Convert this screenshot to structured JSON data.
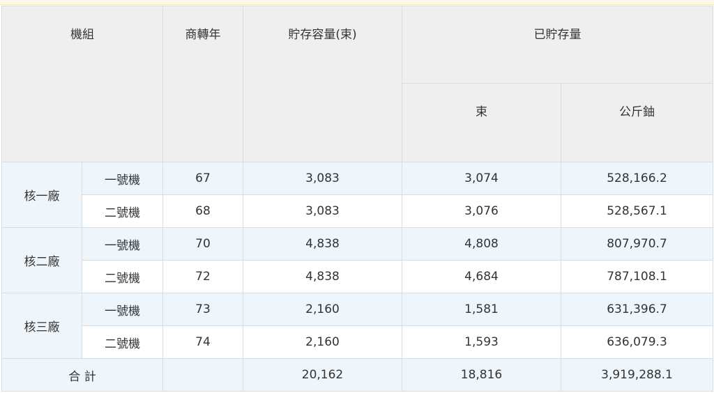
{
  "header": {
    "unit": "機組",
    "commercial_year": "商轉年",
    "capacity": "貯存容量(束)",
    "stored": "已貯存量",
    "stored_bundles": "束",
    "stored_kg": "公斤鈾"
  },
  "plants": [
    {
      "name": "核一廠",
      "units": [
        {
          "unit": "一號機",
          "year": "67",
          "capacity": "3,083",
          "bundles": "3,074",
          "kg": "528,166.2"
        },
        {
          "unit": "二號機",
          "year": "68",
          "capacity": "3,083",
          "bundles": "3,076",
          "kg": "528,567.1"
        }
      ]
    },
    {
      "name": "核二廠",
      "units": [
        {
          "unit": "一號機",
          "year": "70",
          "capacity": "4,838",
          "bundles": "4,808",
          "kg": "807,970.7"
        },
        {
          "unit": "二號機",
          "year": "72",
          "capacity": "4,838",
          "bundles": "4,684",
          "kg": "787,108.1"
        }
      ]
    },
    {
      "name": "核三廠",
      "units": [
        {
          "unit": "一號機",
          "year": "73",
          "capacity": "2,160",
          "bundles": "1,581",
          "kg": "631,396.7"
        },
        {
          "unit": "二號機",
          "year": "74",
          "capacity": "2,160",
          "bundles": "1,593",
          "kg": "636,079.3"
        }
      ]
    }
  ],
  "total": {
    "label": "合 計",
    "year": "",
    "capacity": "20,162",
    "bundles": "18,816",
    "kg": "3,919,288.1"
  }
}
